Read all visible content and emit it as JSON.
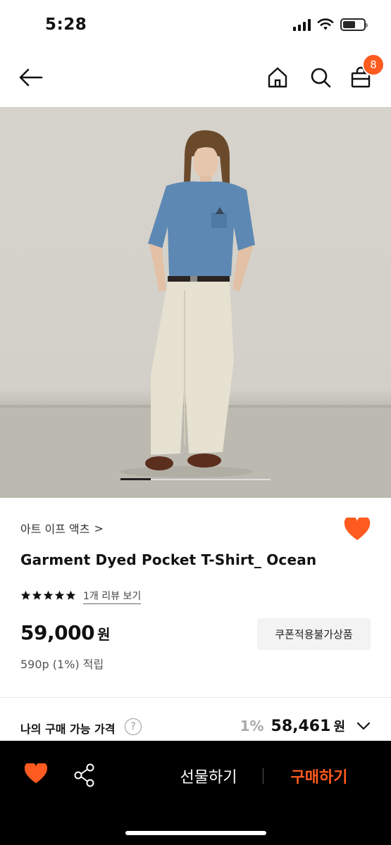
{
  "status_bar": {
    "time": "5:28"
  },
  "nav": {
    "back_icon": "arrow-left-icon",
    "home_icon": "home-icon",
    "search_icon": "search-icon",
    "cart_icon": "shopping-bag-icon",
    "cart_count": "8"
  },
  "hero": {
    "image_count_progress": 0.2
  },
  "product": {
    "brand": "아트 이프 액츠",
    "brand_chevron": ">",
    "title": "Garment Dyed Pocket T-Shirt_ Ocean",
    "rating_stars": 5,
    "review_link": "1개 리뷰 보기",
    "price": "59,000",
    "price_unit": "원",
    "coupon_label": "쿠폰적용불가상품",
    "points": "590p (1%) 적립",
    "liked": true
  },
  "my_price": {
    "label": "나의 구매 가능 가격",
    "help": "?",
    "discount_rate": "1%",
    "value": "58,461",
    "unit": "원"
  },
  "bottom_bar": {
    "gift_label": "선물하기",
    "buy_label": "구매하기"
  },
  "colors": {
    "accent": "#ff5a1f",
    "bottom_bar_bg": "#000000"
  }
}
